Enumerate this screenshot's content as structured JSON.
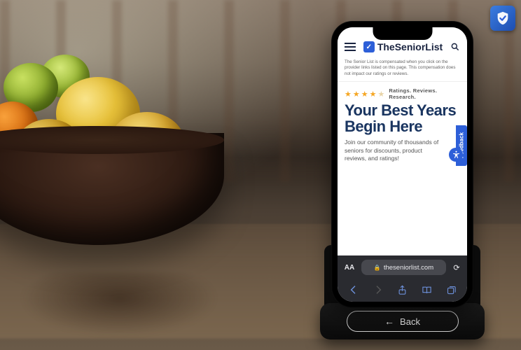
{
  "scene": {
    "description": "Smartphone on a charging stand atop a glass table next to a wooden bowl of lemons and limes"
  },
  "phone": {
    "site": {
      "brand": "TheSeniorList",
      "disclosure": "The Senior List is compensated when you click on the provider links listed on this page. This compensation does not impact our ratings or reviews.",
      "tagline": "Ratings. Reviews. Research.",
      "headline": "Your Best Years Begin Here",
      "subcopy": "Join our community of thousands of seniors for discounts, product reviews, and ratings!",
      "feedback_label": "Feedback"
    },
    "browser": {
      "text_size_label": "AA",
      "url": "theseniorlist.com"
    },
    "stand": {
      "back_label": "Back"
    }
  },
  "badge": {
    "name": "shield-check"
  }
}
